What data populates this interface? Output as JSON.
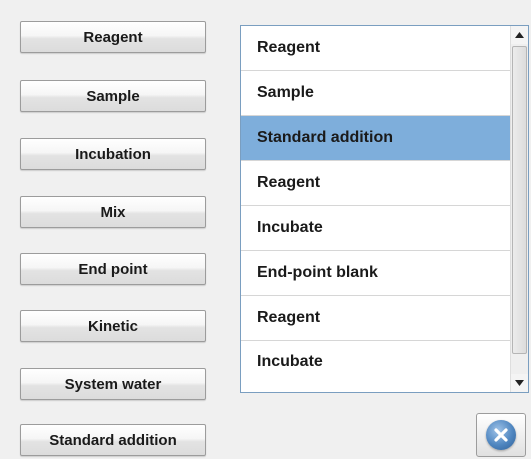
{
  "steps": [
    {
      "label": "Reagent"
    },
    {
      "label": "Sample"
    },
    {
      "label": "Incubation"
    },
    {
      "label": "Mix"
    },
    {
      "label": "End point"
    },
    {
      "label": "Kinetic"
    },
    {
      "label": "System water"
    },
    {
      "label": "Standard addition"
    }
  ],
  "sequence": [
    {
      "label": "Reagent",
      "selected": false
    },
    {
      "label": "Sample",
      "selected": false
    },
    {
      "label": "Standard addition",
      "selected": true
    },
    {
      "label": "Reagent",
      "selected": false
    },
    {
      "label": "Incubate",
      "selected": false
    },
    {
      "label": "End-point blank",
      "selected": false
    },
    {
      "label": "Reagent",
      "selected": false
    },
    {
      "label": "Incubate",
      "selected": false
    }
  ],
  "icons": {
    "scroll_up": "scroll-up-arrow-icon",
    "scroll_down": "scroll-down-arrow-icon",
    "close": "close-x-icon"
  },
  "colors": {
    "selection": "#7eaedb",
    "close_accent": "#4f86c0"
  }
}
